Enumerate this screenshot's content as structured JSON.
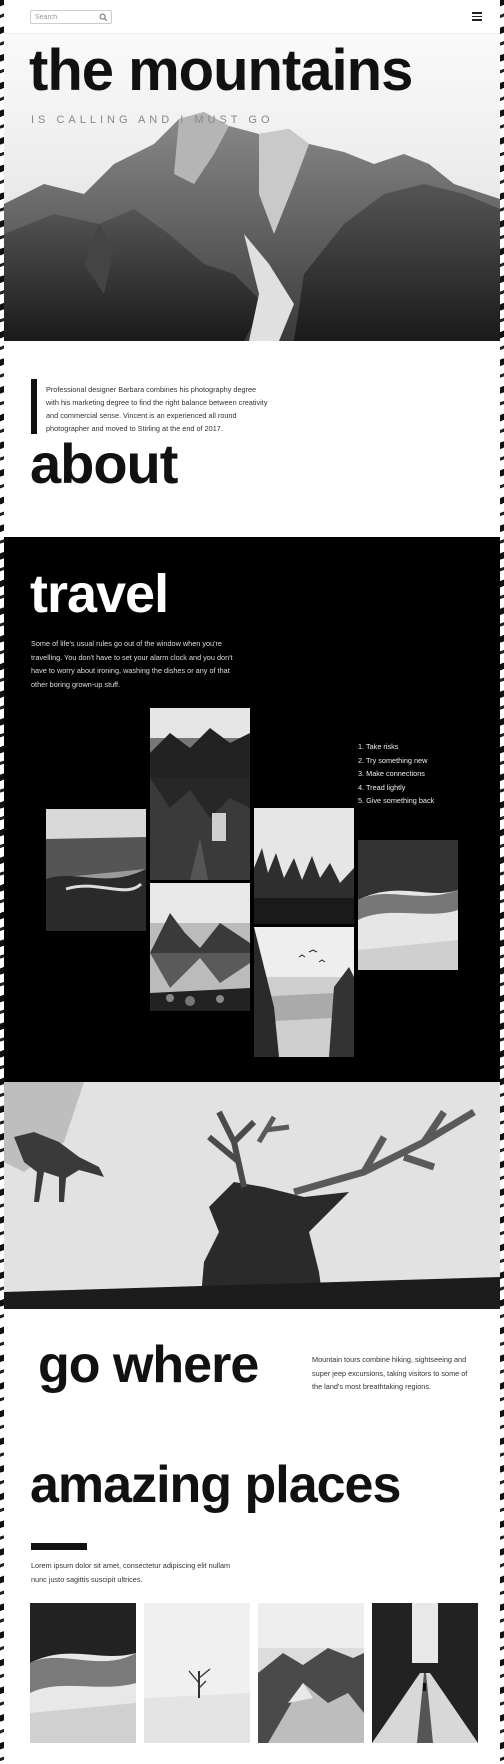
{
  "header": {
    "search_placeholder": "Search",
    "search_icon": "search-icon",
    "menu_icon": "hamburger-menu-icon"
  },
  "hero": {
    "title": "the mountains",
    "subtitle": "IS CALLING AND I MUST GO"
  },
  "about": {
    "text": "Professional designer Barbara combines his photography degree with his marketing degree to find the right balance between creativity and commercial sense. Vincent is an experienced all round photographer and moved to Stirling at the end of 2017.",
    "title": "about"
  },
  "travel": {
    "title": "travel",
    "text": "Some of life's usual rules go out of the window when you're travelling. You don't have to set your alarm clock and you don't have to worry about ironing, washing the dishes or any of that other boring grown-up stuff.",
    "list": [
      "1. Take risks",
      "2. Try something new",
      "3. Make connections",
      "4. Tread lightly",
      "5. Give something back"
    ]
  },
  "go_where": {
    "title": "go where",
    "text": "Mountain tours combine hiking, sightseeing and super jeep excursions, taking visitors to some of the land's most breathtaking regions."
  },
  "amazing": {
    "title": "amazing places",
    "text": "Lorem ipsum dolor sit amet, consectetur adipiscing elit nullam nunc justo sagittis suscipit ultrices."
  },
  "colors": {
    "text": "#111111",
    "background": "#ffffff",
    "travel_bg": "#000000"
  }
}
